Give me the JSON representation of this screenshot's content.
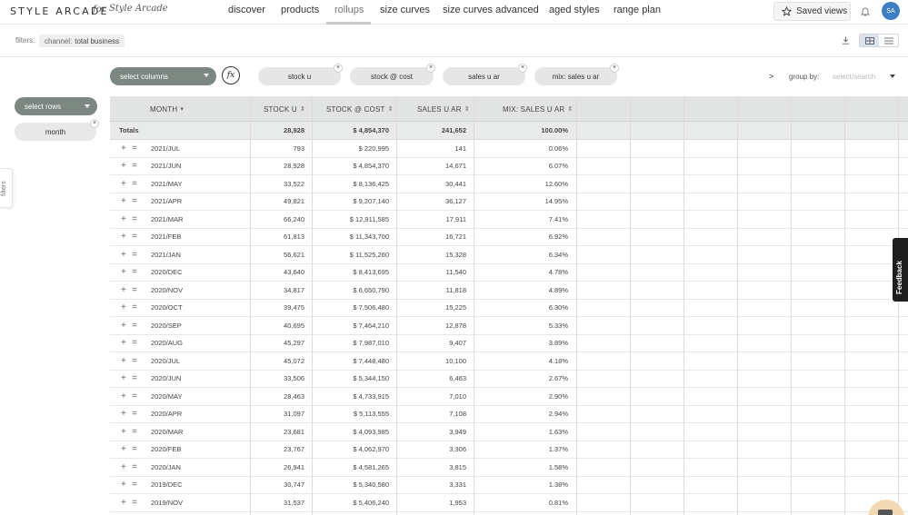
{
  "brand": {
    "name": "STYLE ARCADE",
    "for_text": "for",
    "script_text": "Style Arcade"
  },
  "nav": [
    {
      "label": "discover",
      "active": false
    },
    {
      "label": "products",
      "active": false
    },
    {
      "label": "rollups",
      "active": true
    },
    {
      "label": "size curves",
      "active": false
    },
    {
      "label": "size curves advanced",
      "active": false
    },
    {
      "label": "aged styles",
      "active": false
    },
    {
      "label": "range plan",
      "active": false
    }
  ],
  "header": {
    "saved_views_label": "Saved views",
    "avatar_initials": "SA"
  },
  "filters": {
    "label": "filters:",
    "chip_key": "channel:",
    "chip_value": "total business"
  },
  "columns_bar": {
    "select_columns_label": "select columns",
    "fx_label": "fx",
    "chips": [
      "stock u",
      "stock @ cost",
      "sales u ar",
      "mix: sales u ar"
    ],
    "scroll_arrow": ">",
    "group_by_label": "group by:",
    "group_by_placeholder": "select/search"
  },
  "rows_bar": {
    "select_rows_label": "select rows",
    "row_chips": [
      "month"
    ]
  },
  "side_tab": {
    "label": "filters"
  },
  "feedback": {
    "label": "Feedback"
  },
  "table": {
    "headers": [
      "MONTH",
      "STOCK U",
      "STOCK @ COST",
      "SALES U AR",
      "MIX: SALES U AR"
    ],
    "totals": {
      "label": "Totals",
      "values": [
        "28,928",
        "$ 4,854,370",
        "241,652",
        "100.00%"
      ]
    },
    "rows": [
      {
        "month": "2021/JUL",
        "stock_u": "793",
        "stock_cost": "$ 220,995",
        "sales_u": "141",
        "mix": "0.06%"
      },
      {
        "month": "2021/JUN",
        "stock_u": "28,928",
        "stock_cost": "$ 4,854,370",
        "sales_u": "14,671",
        "mix": "6.07%"
      },
      {
        "month": "2021/MAY",
        "stock_u": "33,522",
        "stock_cost": "$ 8,136,425",
        "sales_u": "30,441",
        "mix": "12.60%"
      },
      {
        "month": "2021/APR",
        "stock_u": "49,821",
        "stock_cost": "$ 9,207,140",
        "sales_u": "36,127",
        "mix": "14.95%"
      },
      {
        "month": "2021/MAR",
        "stock_u": "66,240",
        "stock_cost": "$ 12,911,585",
        "sales_u": "17,911",
        "mix": "7.41%"
      },
      {
        "month": "2021/FEB",
        "stock_u": "61,813",
        "stock_cost": "$ 11,343,700",
        "sales_u": "16,721",
        "mix": "6.92%"
      },
      {
        "month": "2021/JAN",
        "stock_u": "56,621",
        "stock_cost": "$ 11,525,260",
        "sales_u": "15,328",
        "mix": "6.34%"
      },
      {
        "month": "2020/DEC",
        "stock_u": "43,640",
        "stock_cost": "$ 8,413,695",
        "sales_u": "11,540",
        "mix": "4.78%"
      },
      {
        "month": "2020/NOV",
        "stock_u": "34,817",
        "stock_cost": "$ 6,650,790",
        "sales_u": "11,818",
        "mix": "4.89%"
      },
      {
        "month": "2020/OCT",
        "stock_u": "39,475",
        "stock_cost": "$ 7,506,480",
        "sales_u": "15,225",
        "mix": "6.30%"
      },
      {
        "month": "2020/SEP",
        "stock_u": "40,695",
        "stock_cost": "$ 7,464,210",
        "sales_u": "12,878",
        "mix": "5.33%"
      },
      {
        "month": "2020/AUG",
        "stock_u": "45,297",
        "stock_cost": "$ 7,987,010",
        "sales_u": "9,407",
        "mix": "3.89%"
      },
      {
        "month": "2020/JUL",
        "stock_u": "45,072",
        "stock_cost": "$ 7,448,480",
        "sales_u": "10,100",
        "mix": "4.18%"
      },
      {
        "month": "2020/JUN",
        "stock_u": "33,506",
        "stock_cost": "$ 5,344,150",
        "sales_u": "6,463",
        "mix": "2.67%"
      },
      {
        "month": "2020/MAY",
        "stock_u": "28,463",
        "stock_cost": "$ 4,733,915",
        "sales_u": "7,010",
        "mix": "2.90%"
      },
      {
        "month": "2020/APR",
        "stock_u": "31,097",
        "stock_cost": "$ 5,113,555",
        "sales_u": "7,108",
        "mix": "2.94%"
      },
      {
        "month": "2020/MAR",
        "stock_u": "23,681",
        "stock_cost": "$ 4,093,985",
        "sales_u": "3,949",
        "mix": "1.63%"
      },
      {
        "month": "2020/FEB",
        "stock_u": "23,767",
        "stock_cost": "$ 4,062,970",
        "sales_u": "3,306",
        "mix": "1.37%"
      },
      {
        "month": "2020/JAN",
        "stock_u": "26,941",
        "stock_cost": "$ 4,581,265",
        "sales_u": "3,815",
        "mix": "1.58%"
      },
      {
        "month": "2019/DEC",
        "stock_u": "30,747",
        "stock_cost": "$ 5,340,580",
        "sales_u": "3,331",
        "mix": "1.38%"
      },
      {
        "month": "2019/NOV",
        "stock_u": "31,537",
        "stock_cost": "$ 5,406,240",
        "sales_u": "1,953",
        "mix": "0.81%"
      }
    ]
  }
}
